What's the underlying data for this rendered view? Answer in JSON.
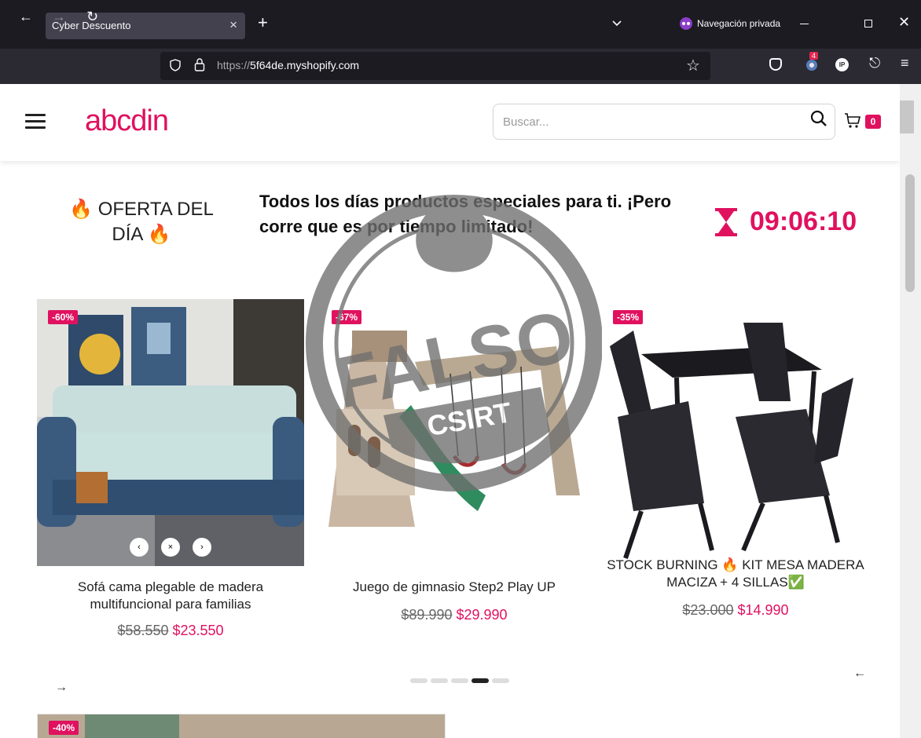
{
  "browser": {
    "tab_title": "Cyber Descuento",
    "private_label": "Navegación privada",
    "url_protocol": "https://",
    "url_host": "5f64de.myshopify.com",
    "extension_badge": "4",
    "ip_extension": "IP"
  },
  "header": {
    "logo": "abcdin",
    "search_placeholder": "Buscar...",
    "cart_count": "0"
  },
  "promo": {
    "left_line1": "🔥 OFERTA DEL",
    "left_line2": "DÍA 🔥",
    "message": "Todos los días productos especiales para ti. ¡Pero corre que es por tiempo limitado!",
    "timer": "09:06:10"
  },
  "stamp": {
    "word": "FALSO",
    "org": "CSIRT"
  },
  "products": [
    {
      "badge": "-60%",
      "title": "Sofá cama plegable de madera multifuncional para familias",
      "old_price": "$58.550",
      "new_price": "$23.550"
    },
    {
      "badge": "-67%",
      "title": "Juego de gimnasio Step2 Play UP",
      "old_price": "$89.990",
      "new_price": "$29.990"
    },
    {
      "badge": "-35%",
      "title": "STOCK BURNING 🔥 KIT MESA MADERA MACIZA + 4 SILLAS✅",
      "old_price": "$23.000",
      "new_price": "$14.990"
    }
  ],
  "next_product": {
    "badge": "-40%"
  },
  "carousel": {
    "prev": "←",
    "next": "→"
  },
  "colors": {
    "brand": "#e0115f",
    "chrome_dark": "#1c1b22",
    "chrome_nav": "#2b2a33"
  }
}
